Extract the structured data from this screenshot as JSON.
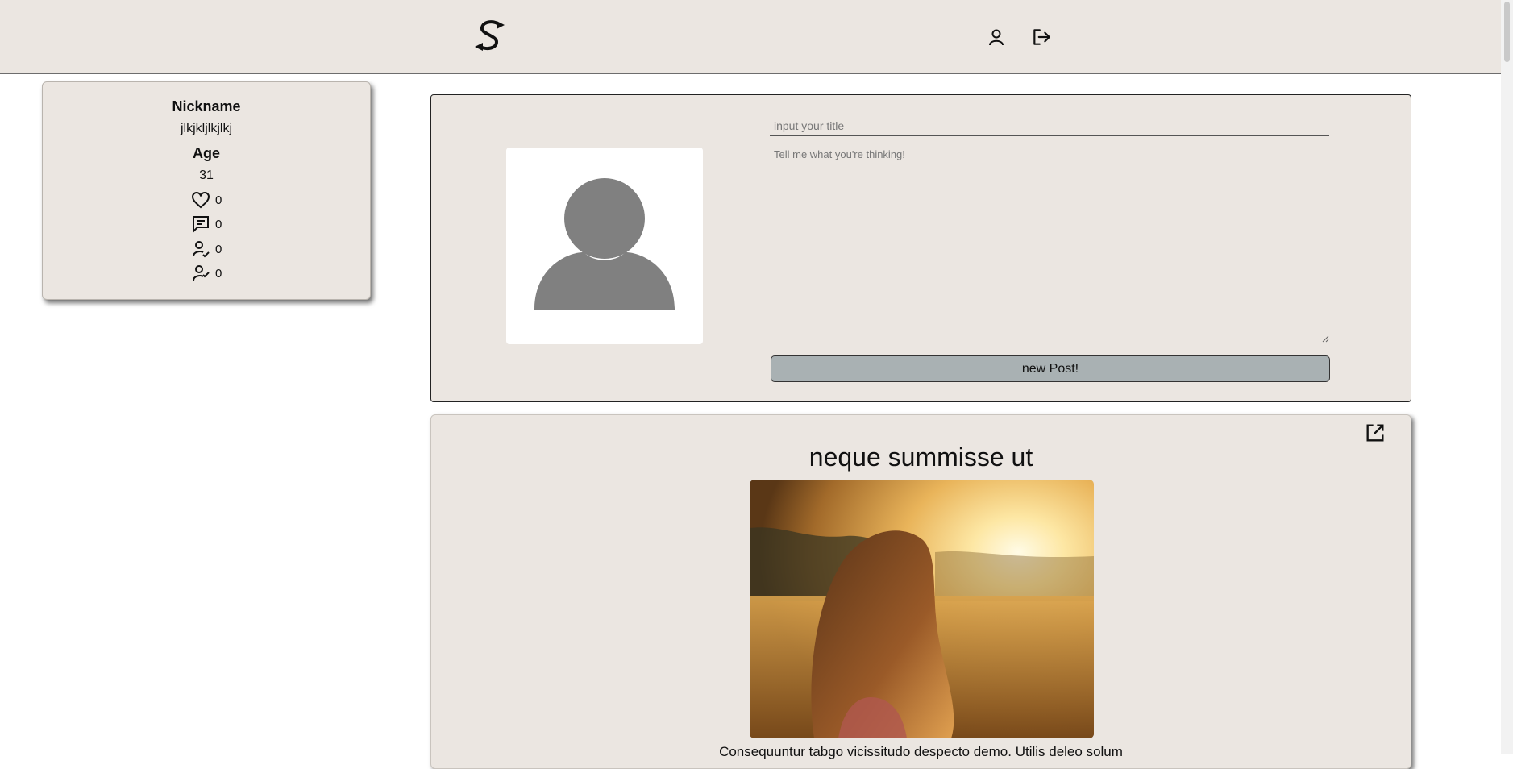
{
  "header": {
    "logo": "logo-icon",
    "profile_icon": "user-icon",
    "logout_icon": "logout-icon"
  },
  "profile": {
    "nickname_label": "Nickname",
    "nickname_value": "jlkjkljlkjlkj",
    "age_label": "Age",
    "age_value": "31",
    "stats": [
      {
        "icon": "heart-icon",
        "value": "0"
      },
      {
        "icon": "comment-icon",
        "value": "0"
      },
      {
        "icon": "user-check-icon",
        "value": "0"
      },
      {
        "icon": "user-check-icon",
        "value": "0"
      }
    ]
  },
  "compose": {
    "title_placeholder": "input your title",
    "body_placeholder": "Tell me what you're thinking!",
    "submit_label": "new Post!"
  },
  "post": {
    "title": "neque summisse ut",
    "body": "Consequuntur tabgo vicissitudo despecto demo. Utilis deleo solum",
    "open_icon": "external-link-icon"
  },
  "colors": {
    "surface": "#ebe6e1",
    "button": "#a9b1b3",
    "avatar_gray": "#808080"
  }
}
